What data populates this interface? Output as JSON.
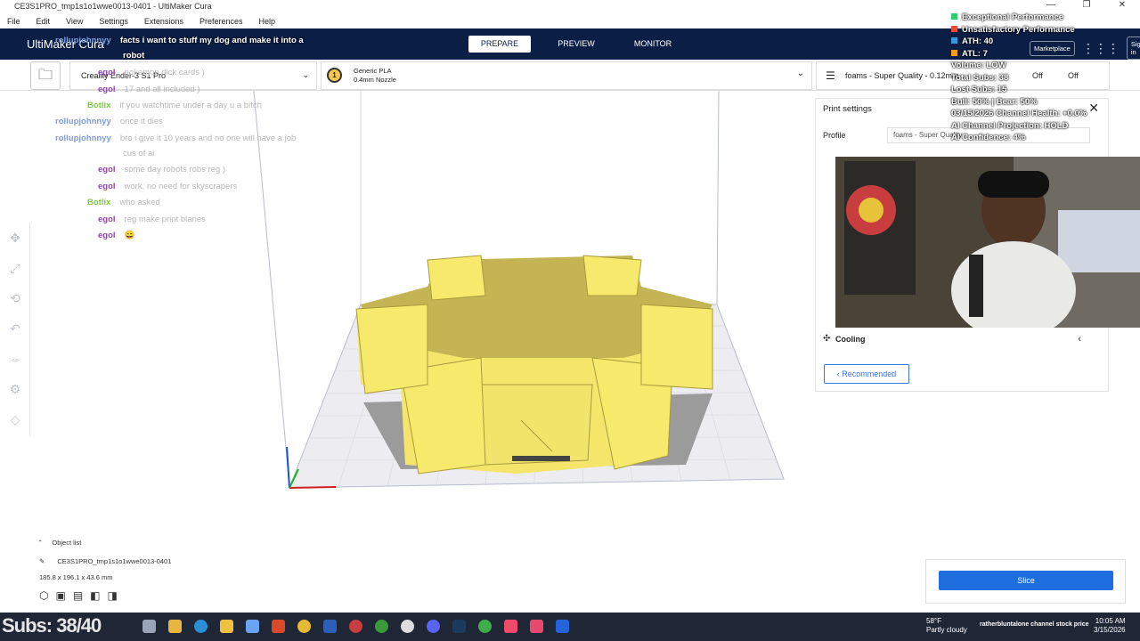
{
  "window": {
    "title": "CE3S1PRO_tmp1s1o1wwe0013-0401 - UltiMaker Cura",
    "controls": [
      "—",
      "❐",
      "✕"
    ]
  },
  "menu": [
    "File",
    "Edit",
    "View",
    "Settings",
    "Extensions",
    "Preferences",
    "Help"
  ],
  "header": {
    "brand": "UltiMaker Cura",
    "tabs": [
      "PREPARE",
      "PREVIEW",
      "MONITOR"
    ],
    "marketplace": "Marketplace",
    "signin": "Sign in"
  },
  "toolbar": {
    "printer": "Creality Ender-3 S1 Pro",
    "material": "Generic PLA",
    "nozzle": "0.4mm Nozzle",
    "extruder_num": "1",
    "profile": "foams - Super Quality - 0.12mm",
    "support": "Off",
    "adhesion": "Off"
  },
  "print_settings": {
    "title": "Print settings",
    "profile_label": "Profile",
    "profile_value": "foams - Super Quality",
    "cooling": "Cooling",
    "recommended": "Recommended"
  },
  "overlay": [
    {
      "text": "Exceptional Performance",
      "color": "#2ecc71"
    },
    {
      "text": "Unsatisfactory Performance",
      "color": "#e74c3c"
    },
    {
      "text": "ATH: 40",
      "color": "#3498db"
    },
    {
      "text": "ATL: 7",
      "color": "#f39c12"
    },
    {
      "text": "Volume: LOW",
      "color": ""
    },
    {
      "text": "Total Subs: 38",
      "color": ""
    },
    {
      "text": "Lost Subs: 15",
      "color": ""
    },
    {
      "text": "Bull: 50% | Bear: 50%",
      "color": ""
    },
    {
      "text": "03/15/2026 Channel Health: +0.0%",
      "color": ""
    },
    {
      "text": "AI Channel Projection: HOLD",
      "color": ""
    },
    {
      "text": "AI Confidence: 4%",
      "color": ""
    }
  ],
  "chat": [
    {
      "user": "rollupjohnnyy",
      "msg": "facts i want to stuff my dog and make it into a",
      "color": "#7b9ee0",
      "white": true
    },
    {
      "user": "",
      "msg": "robot",
      "color": "",
      "white": true
    },
    {
      "user": "egol",
      "msg": "pokemon dick cards )",
      "color": "#8e44ad",
      "white": false
    },
    {
      "user": "egol",
      "msg": "17 and all included )",
      "color": "#8e44ad",
      "white": false
    },
    {
      "user": "Botlix",
      "msg": "if you watchtime under a day u a bitch",
      "color": "#7ac943",
      "white": false
    },
    {
      "user": "rollupjohnnyy",
      "msg": "once it dies",
      "color": "#7b9ee0",
      "white": false
    },
    {
      "user": "rollupjohnnyy",
      "msg": "bro i give it 10 years and no one will have a job",
      "color": "#7b9ee0",
      "white": false
    },
    {
      "user": "",
      "msg": "cus of ai",
      "color": "",
      "white": false
    },
    {
      "user": "egol",
      "msg": "some day robots robs reg )",
      "color": "#8e44ad",
      "white": false
    },
    {
      "user": "egol",
      "msg": "work, no need for skyscrapers",
      "color": "#8e44ad",
      "white": false
    },
    {
      "user": "Botlix",
      "msg": "who asked",
      "color": "#7ac943",
      "white": false
    },
    {
      "user": "egol",
      "msg": "reg make print blanes",
      "color": "#8e44ad",
      "white": false
    },
    {
      "user": "egol",
      "msg": "😄",
      "color": "#8e44ad",
      "white": false
    }
  ],
  "objects": {
    "heading": "Object list",
    "file": "CE3S1PRO_tmp1s1o1wwe0013-0401",
    "dims": "185.8 x 196.1 x 43.6 mm"
  },
  "slice": "Slice",
  "taskbar": {
    "subs": "Subs: 38/40",
    "weather_temp": "58°F",
    "weather_desc": "Partly cloudy",
    "tray_text": "ratherbluntalone channel stock price",
    "time": "10:05 AM",
    "date": "3/15/2026"
  },
  "colors": {
    "header_bg": "#0b1e45",
    "accent": "#1e6ee0",
    "model": "#f5e56b",
    "build_plate": "#e9e9ee"
  }
}
